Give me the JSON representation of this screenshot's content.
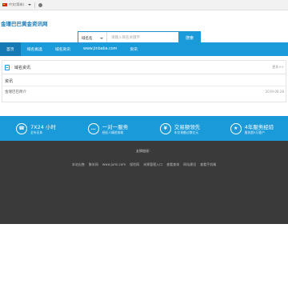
{
  "topbar": {
    "language": "中文(简体)",
    "flag_icon": "cn-flag-icon",
    "user_icon": "user-dot-icon"
  },
  "header": {
    "logo_text": "金瑾巴巴黄金资讯网",
    "search": {
      "type_label": "域名名",
      "placeholder": "请输入域名关键字",
      "button_label": "搜索"
    }
  },
  "nav": {
    "items": [
      {
        "label": "首页",
        "active": true
      },
      {
        "label": "域名挑选"
      },
      {
        "label": "域名资讯"
      },
      {
        "label": "www.jinbaba.com"
      },
      {
        "label": "资讯"
      }
    ]
  },
  "news": {
    "title": "域名资讯",
    "more": "更多>>",
    "subtitle": "资讯",
    "rows": [
      {
        "title": "金瑾巴巴简介",
        "date": "2019-06-28"
      }
    ]
  },
  "features": [
    {
      "icon": "headset-icon",
      "big": "7X24 小时",
      "small": "全年无休"
    },
    {
      "icon": "chat-icon",
      "big": "一对一服务",
      "small": "经纪人精进协助"
    },
    {
      "icon": "yen-icon",
      "big": "交易额领先",
      "small": "年交易额过数亿元"
    },
    {
      "icon": "trophy-icon",
      "big": "4年服务经验",
      "small": "服务超5万客户"
    }
  ],
  "footer": {
    "friend_label": "友情链接：",
    "links": [
      "本站出售",
      "聚米网",
      "www.jumi.com",
      "保险网",
      "米果管理入口",
      "查看查询",
      "网站建设",
      "查看手机端"
    ]
  },
  "colors": {
    "brand_blue": "#1b9ad9",
    "dark_footer": "#3a3a3a"
  }
}
